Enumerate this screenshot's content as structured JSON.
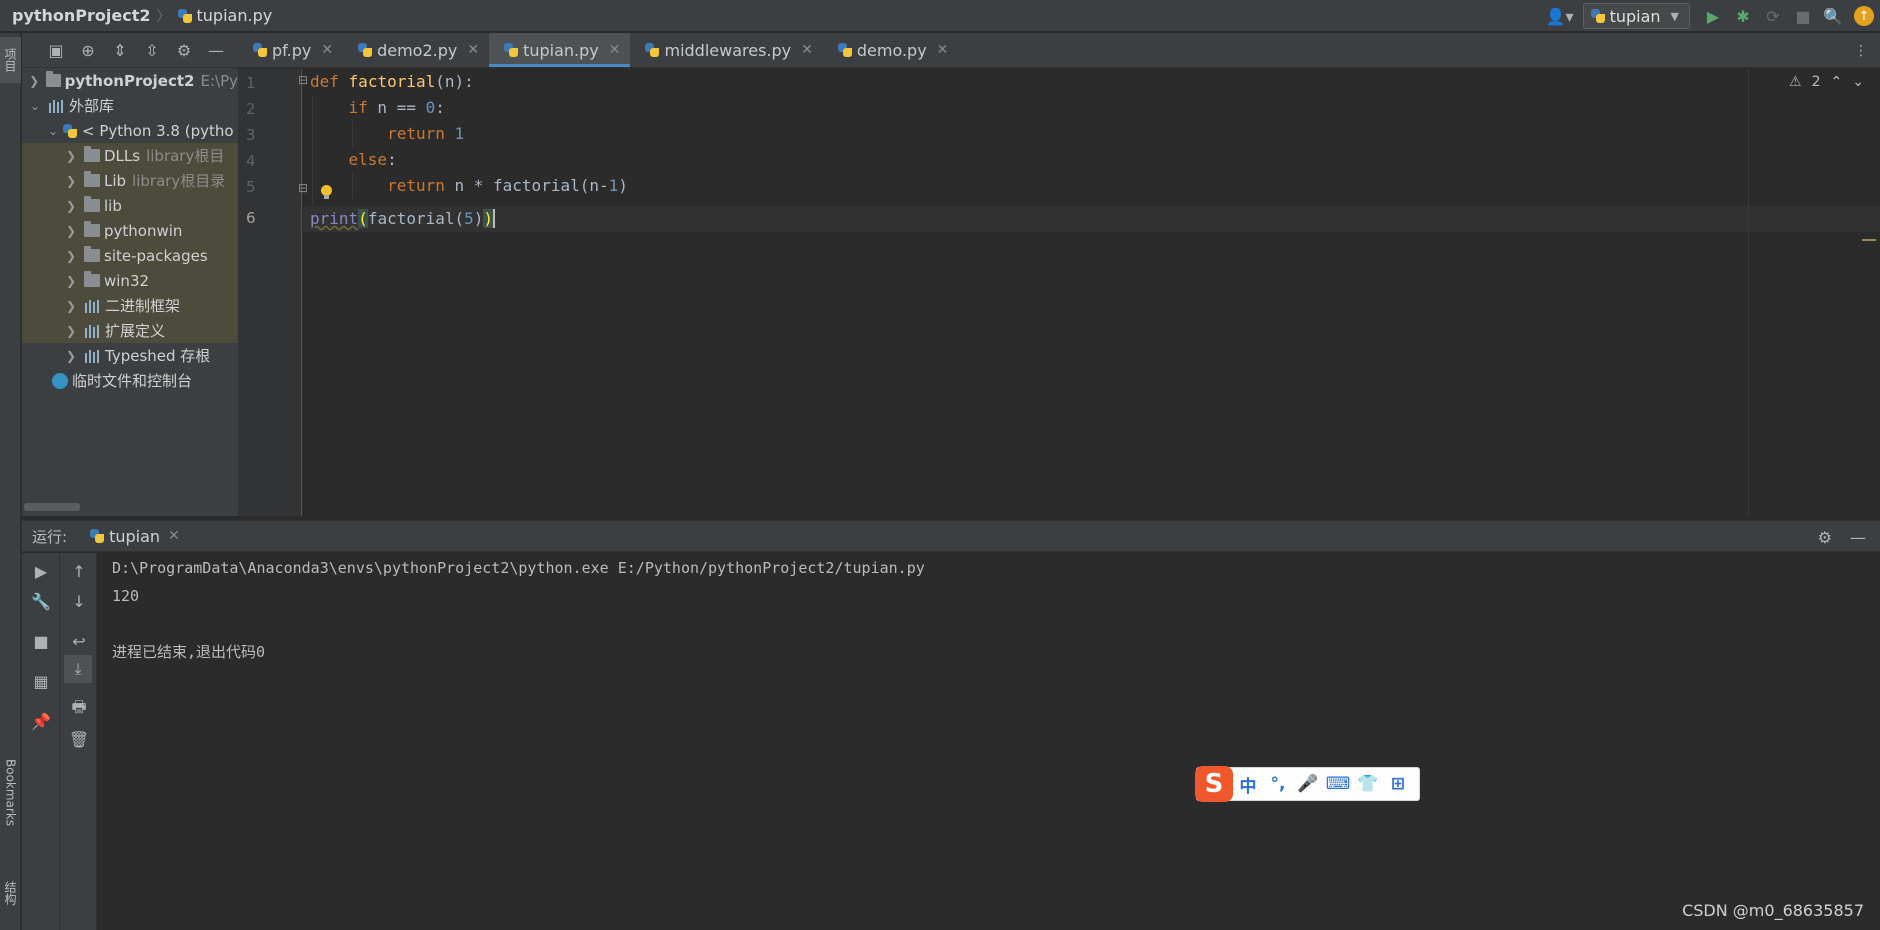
{
  "navbar": {
    "project": "pythonProject2",
    "file": "tupian.py",
    "run_config": "tupian"
  },
  "left_strip": {
    "project_tab": "项目",
    "bookmarks_tab": "Bookmarks",
    "structure_tab": "结构"
  },
  "project_tree": {
    "root": {
      "label": "pythonProject2",
      "hint": "E:\\Py"
    },
    "external_libs": "外部库",
    "python_sdk": "< Python 3.8 (pytho",
    "items": [
      {
        "label": "DLLs",
        "hint": "library根目"
      },
      {
        "label": "Lib",
        "hint": "library根目录"
      },
      {
        "label": "lib",
        "hint": ""
      },
      {
        "label": "pythonwin",
        "hint": ""
      },
      {
        "label": "site-packages",
        "hint": ""
      },
      {
        "label": "win32",
        "hint": ""
      },
      {
        "label": "二进制框架",
        "hint": ""
      },
      {
        "label": "扩展定义",
        "hint": ""
      },
      {
        "label": "Typeshed 存根",
        "hint": ""
      }
    ],
    "scratches": "临时文件和控制台"
  },
  "tabs": [
    {
      "label": "pf.py",
      "active": false
    },
    {
      "label": "demo2.py",
      "active": false
    },
    {
      "label": "tupian.py",
      "active": true
    },
    {
      "label": "middlewares.py",
      "active": false
    },
    {
      "label": "demo.py",
      "active": false
    }
  ],
  "editor": {
    "line_numbers": [
      "1",
      "2",
      "3",
      "4",
      "5",
      "6"
    ],
    "inspection_count": "2",
    "code": {
      "l1_kw": "def",
      "l1_fn": "factorial",
      "l1_rest": "(n):",
      "l2_kw": "if",
      "l2_mid": " n == ",
      "l2_num": "0",
      "l2_end": ":",
      "l3_kw": "return",
      "l3_num": "1",
      "l4_kw": "else",
      "l4_end": ":",
      "l5_kw": "return",
      "l5_mid": " n * factorial(n-",
      "l5_num": "1",
      "l5_end": ")",
      "l6_bi": "print",
      "l6_open": "(",
      "l6_mid": "factorial(",
      "l6_num": "5",
      "l6_close1": ")",
      "l6_close2": ")"
    }
  },
  "run_panel": {
    "title": "运行:",
    "tab": "tupian",
    "console": [
      "D:\\ProgramData\\Anaconda3\\envs\\pythonProject2\\python.exe E:/Python/pythonProject2/tupian.py",
      "120",
      "",
      "进程已结束,退出代码0"
    ]
  },
  "ime": {
    "logo": "S",
    "items": [
      "中",
      "°,",
      "🎤",
      "⌨",
      "👕",
      "⊞"
    ]
  },
  "watermark": "CSDN @m0_68635857"
}
